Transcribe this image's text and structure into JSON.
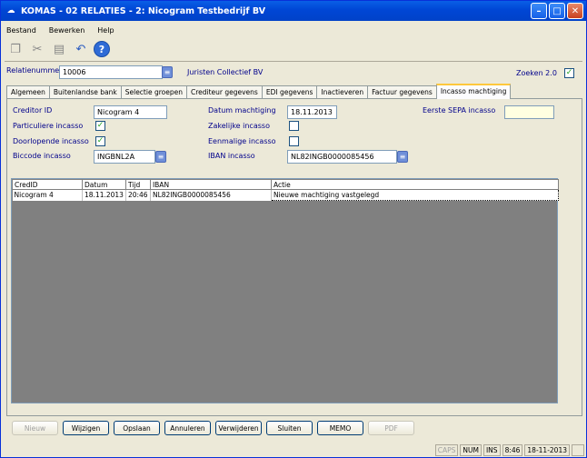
{
  "window": {
    "title": "KOMAS - 02 RELATIES - 2: Nicogram Testbedrijf BV"
  },
  "menu": {
    "items": [
      "Bestand",
      "Bewerken",
      "Help"
    ]
  },
  "header": {
    "relatienummer_label": "Relatienummer",
    "relatienummer_value": "10006",
    "relation_name": "Juristen Collectief BV",
    "zoeken_label": "Zoeken 2.0",
    "zoeken_checked": "✓"
  },
  "tabs": [
    "Algemeen",
    "Buitenlandse bank",
    "Selectie groepen",
    "Crediteur gegevens",
    "EDI gegevens",
    "Inactieveren",
    "Factuur gegevens",
    "Incasso machtiging"
  ],
  "form": {
    "creditor_id_label": "Creditor ID",
    "creditor_id_value": "Nicogram 4",
    "particuliere_label": "Particuliere incasso",
    "particuliere_checked": "✓",
    "doorlopende_label": "Doorlopende incasso",
    "doorlopende_checked": "✓",
    "biccode_label": "Biccode incasso",
    "biccode_value": "INGBNL2A",
    "datum_label": "Datum machtiging",
    "datum_value": "18.11.2013",
    "zakelijke_label": "Zakelijke incasso",
    "zakelijke_checked": "",
    "eenmalige_label": "Eenmalige incasso",
    "eenmalige_checked": "",
    "iban_label": "IBAN incasso",
    "iban_value": "NL82INGB0000085456",
    "eerste_sepa_label": "Eerste SEPA incasso",
    "eerste_sepa_value": ""
  },
  "table": {
    "columns": [
      "CredID",
      "Datum",
      "Tijd",
      "IBAN",
      "Actie"
    ],
    "rows": [
      [
        "Nicogram 4",
        "18.11.2013",
        "20:46",
        "NL82INGB0000085456",
        "Nieuwe machtiging vastgelegd"
      ]
    ]
  },
  "buttons": {
    "nieuw": "Nieuw",
    "wijzigen": "Wijzigen",
    "opslaan": "Opslaan",
    "annuleren": "Annuleren",
    "verwijderen": "Verwijderen",
    "sluiten": "Sluiten",
    "memo": "MEMO",
    "pdf": "PDF"
  },
  "status": {
    "caps": "CAPS",
    "num": "NUM",
    "ins": "INS",
    "time": "8:46",
    "date": "18-11-2013"
  }
}
